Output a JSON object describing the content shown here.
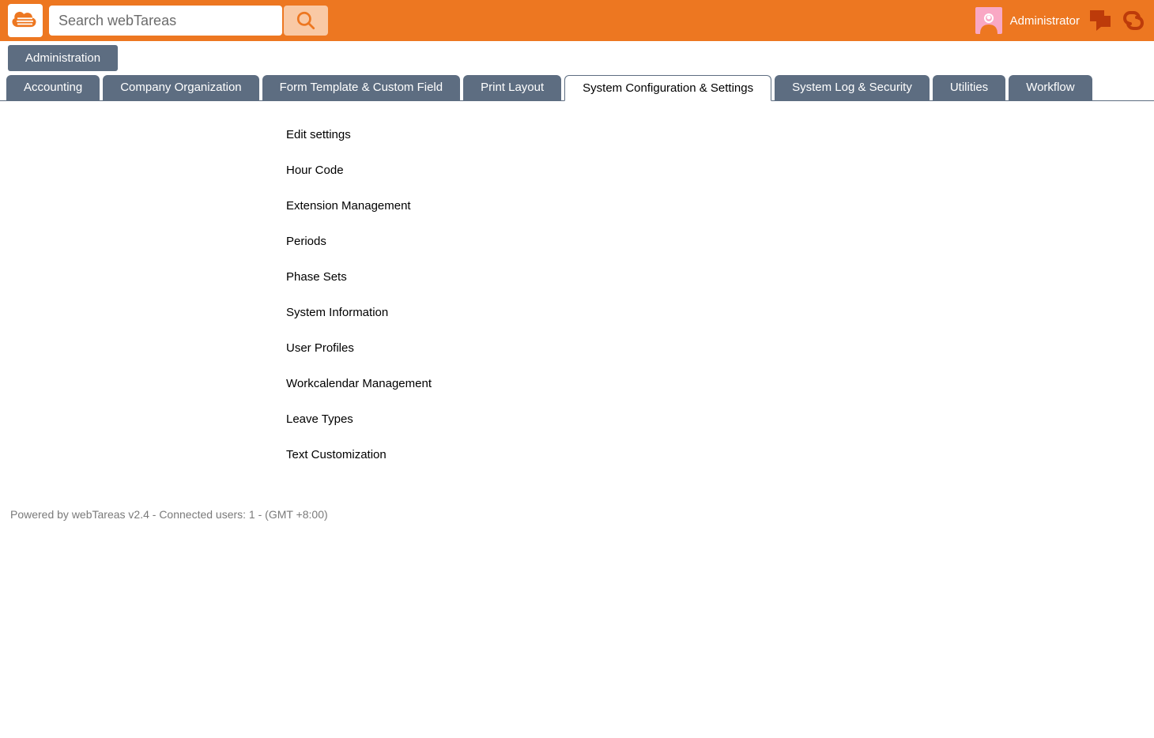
{
  "header": {
    "search_placeholder": "Search webTareas",
    "user_name": "Administrator"
  },
  "breadcrumb": {
    "label": "Administration"
  },
  "tabs": [
    {
      "label": "Accounting",
      "active": false
    },
    {
      "label": "Company Organization",
      "active": false
    },
    {
      "label": "Form Template & Custom Field",
      "active": false
    },
    {
      "label": "Print Layout",
      "active": false
    },
    {
      "label": "System Configuration & Settings",
      "active": true
    },
    {
      "label": "System Log & Security",
      "active": false
    },
    {
      "label": "Utilities",
      "active": false
    },
    {
      "label": "Workflow",
      "active": false
    }
  ],
  "menu_items": [
    "Edit settings",
    "Hour Code",
    "Extension Management",
    "Periods",
    "Phase Sets",
    "System Information",
    "User Profiles",
    "Workcalendar Management",
    "Leave Types",
    "Text Customization"
  ],
  "footer": {
    "text": "Powered by webTareas v2.4 - Connected users: 1 - (GMT +8:00)"
  }
}
